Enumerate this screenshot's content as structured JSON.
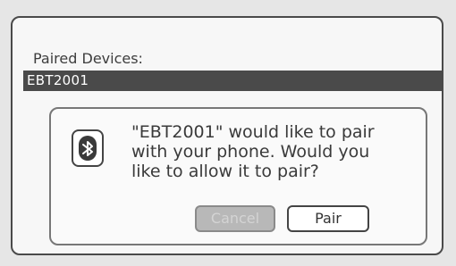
{
  "paired_devices": {
    "label": "Paired Devices:",
    "selected_device": "EBT2001"
  },
  "pair_dialog": {
    "icon": "bluetooth-icon",
    "message_line_1": "\"EBT2001\"  would like to pair",
    "message_line_2": "with your phone. Would you",
    "message_line_3": "like to allow it to pair?",
    "cancel_label": "Cancel",
    "pair_label": "Pair",
    "cancel_disabled": true
  },
  "colors": {
    "selected_bar": "#4a4a4a",
    "disabled_button": "#b8b8b8"
  }
}
